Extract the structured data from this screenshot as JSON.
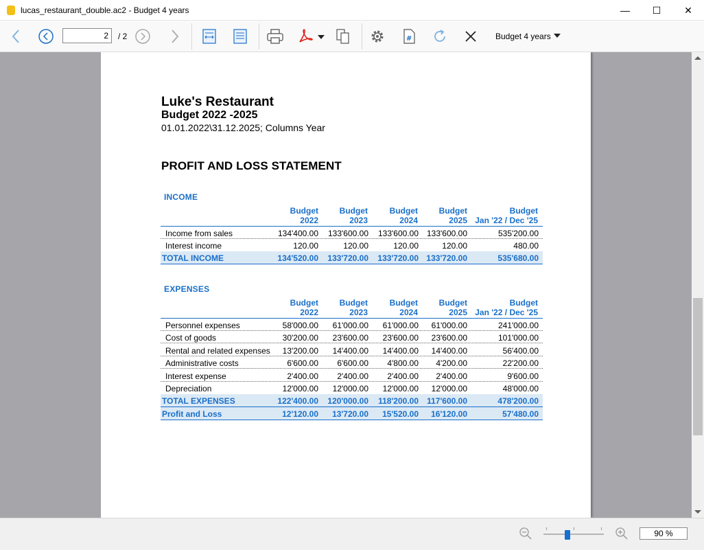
{
  "window": {
    "title": "lucas_restaurant_double.ac2 - Budget 4 years",
    "minimize": "—",
    "maximize": "☐",
    "close": "✕"
  },
  "toolbar": {
    "current_page": "2",
    "total_pages": "/ 2",
    "report_name": "Budget 4 years",
    "icons": [
      "back-arrow-icon",
      "prev-page-icon",
      "next-page-icon",
      "forward-arrow-icon",
      "fit-width-icon",
      "fit-page-icon",
      "print-icon",
      "pdf-icon",
      "copy-icon",
      "settings-icon",
      "page-number-icon",
      "refresh-icon",
      "close-icon",
      "dropdown-caret-icon"
    ]
  },
  "report": {
    "company": "Luke's Restaurant",
    "subtitle": "Budget 2022 -2025",
    "period": "01.01.2022\\31.12.2025; Columns Year",
    "statement_title": "PROFIT AND LOSS STATEMENT",
    "columns": [
      {
        "line1": "Budget",
        "line2": "2022"
      },
      {
        "line1": "Budget",
        "line2": "2023"
      },
      {
        "line1": "Budget",
        "line2": "2024"
      },
      {
        "line1": "Budget",
        "line2": "2025"
      },
      {
        "line1": "Budget",
        "line2": "Jan '22 / Dec '25"
      }
    ],
    "income": {
      "label": "INCOME",
      "rows": [
        {
          "label": "Income from sales",
          "values": [
            "134'400.00",
            "133'600.00",
            "133'600.00",
            "133'600.00",
            "535'200.00"
          ]
        },
        {
          "label": "Interest income",
          "values": [
            "120.00",
            "120.00",
            "120.00",
            "120.00",
            "480.00"
          ]
        }
      ],
      "total": {
        "label": "TOTAL INCOME",
        "values": [
          "134'520.00",
          "133'720.00",
          "133'720.00",
          "133'720.00",
          "535'680.00"
        ]
      }
    },
    "expenses": {
      "label": "EXPENSES",
      "rows": [
        {
          "label": "Personnel expenses",
          "values": [
            "58'000.00",
            "61'000.00",
            "61'000.00",
            "61'000.00",
            "241'000.00"
          ]
        },
        {
          "label": "Cost of goods",
          "values": [
            "30'200.00",
            "23'600.00",
            "23'600.00",
            "23'600.00",
            "101'000.00"
          ]
        },
        {
          "label": "Rental and related expenses",
          "values": [
            "13'200.00",
            "14'400.00",
            "14'400.00",
            "14'400.00",
            "56'400.00"
          ]
        },
        {
          "label": "Administrative costs",
          "values": [
            "6'600.00",
            "6'600.00",
            "4'800.00",
            "4'200.00",
            "22'200.00"
          ]
        },
        {
          "label": "Interest expense",
          "values": [
            "2'400.00",
            "2'400.00",
            "2'400.00",
            "2'400.00",
            "9'600.00"
          ]
        },
        {
          "label": "Depreciation",
          "values": [
            "12'000.00",
            "12'000.00",
            "12'000.00",
            "12'000.00",
            "48'000.00"
          ]
        }
      ],
      "total": {
        "label": "TOTAL EXPENSES",
        "values": [
          "122'400.00",
          "120'000.00",
          "118'200.00",
          "117'600.00",
          "478'200.00"
        ]
      }
    },
    "profit_loss": {
      "label": "Profit and Loss",
      "values": [
        "12'120.00",
        "13'720.00",
        "15'520.00",
        "16'120.00",
        "57'480.00"
      ]
    }
  },
  "statusbar": {
    "zoom": "90  %",
    "zoom_level": 0.4
  },
  "colors": {
    "accent": "#1a6fc9",
    "total_row_bg": "#dbe9f5",
    "viewer_bg": "#a6a5aa"
  }
}
